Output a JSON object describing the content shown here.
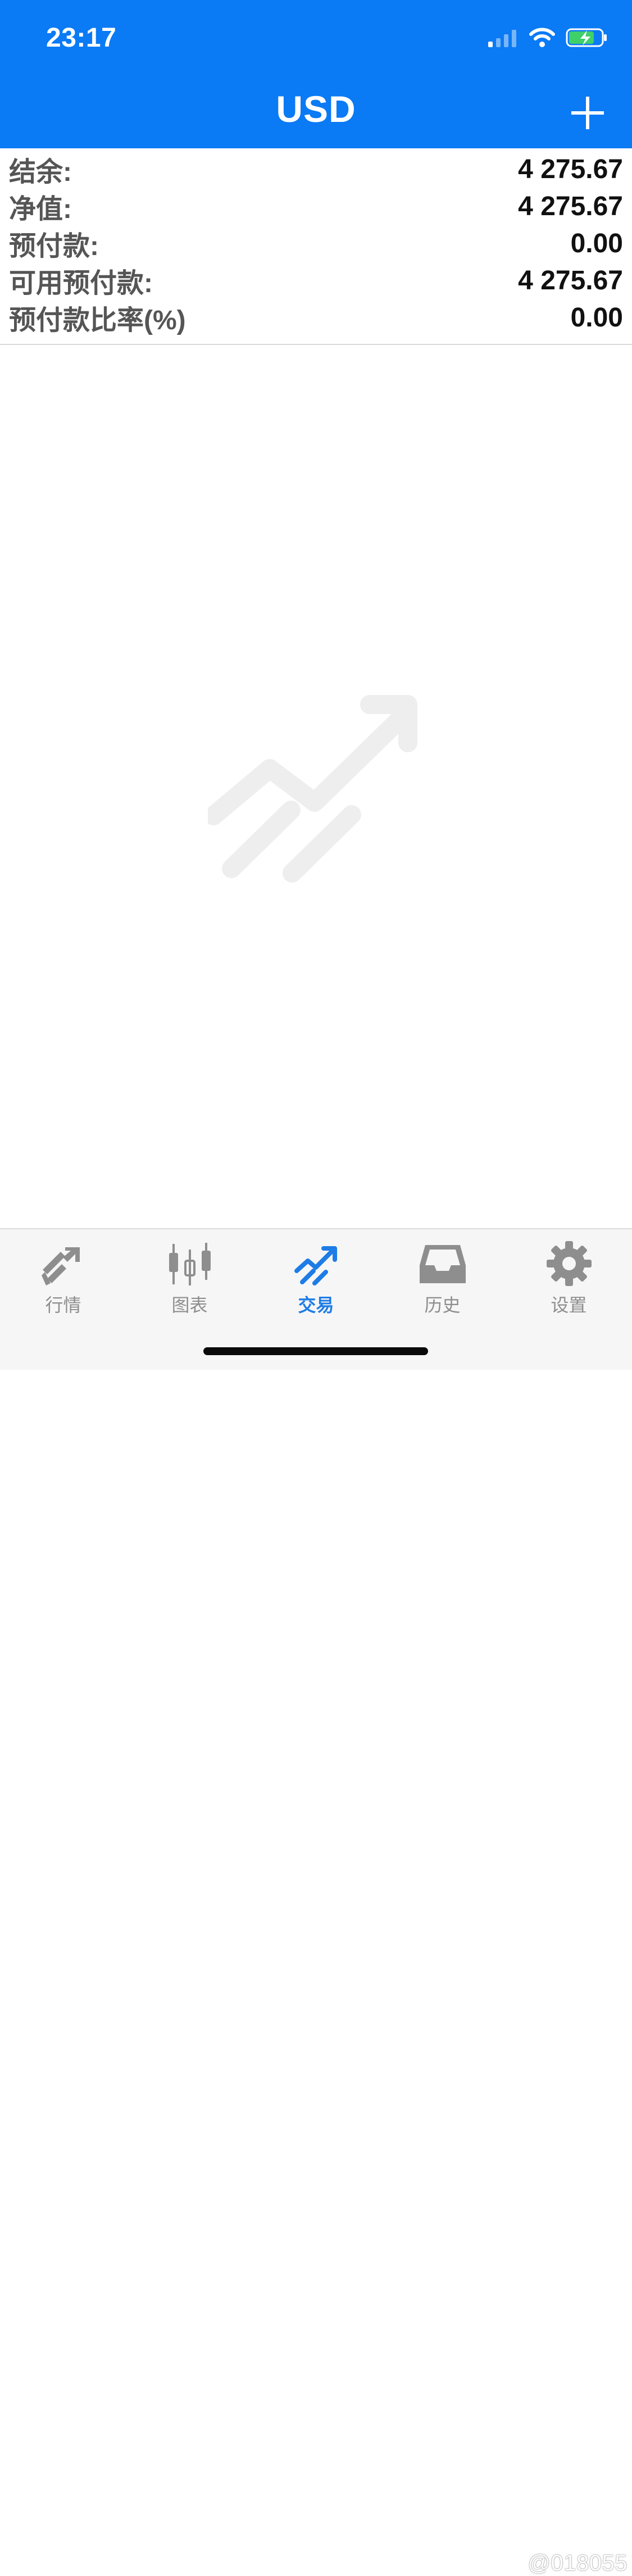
{
  "status_bar": {
    "time": "23:17",
    "icons": [
      "cellular-signal-icon",
      "wifi-icon",
      "battery-charging-icon"
    ]
  },
  "header": {
    "title": "USD",
    "add_icon": "plus-icon",
    "background_color": "#0a7af5"
  },
  "account": {
    "rows": [
      {
        "label": "结余:",
        "value": "4 275.67"
      },
      {
        "label": "净值:",
        "value": "4 275.67"
      },
      {
        "label": "预付款:",
        "value": "0.00"
      },
      {
        "label": "可用预付款:",
        "value": "4 275.67"
      },
      {
        "label": "预付款比率(%)",
        "value": "0.00"
      }
    ]
  },
  "empty_state": {
    "icon": "trade-chart-icon"
  },
  "tabbar": {
    "active_color": "#1d7ce6",
    "inactive_color": "#8e8e8e",
    "tabs": [
      {
        "label": "行情",
        "icon": "quotes-icon",
        "active": false
      },
      {
        "label": "图表",
        "icon": "candlestick-icon",
        "active": false
      },
      {
        "label": "交易",
        "icon": "trade-icon",
        "active": true
      },
      {
        "label": "历史",
        "icon": "inbox-icon",
        "active": false
      },
      {
        "label": "设置",
        "icon": "gear-icon",
        "active": false
      }
    ]
  },
  "watermark": "@018055"
}
